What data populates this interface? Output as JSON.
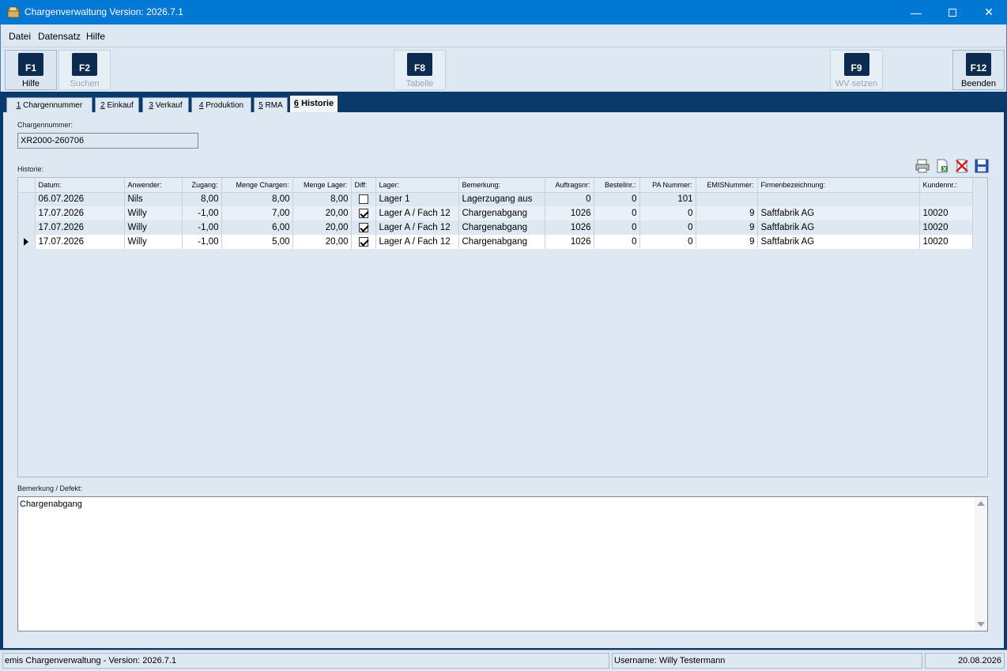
{
  "window": {
    "title": "Chargenverwaltung Version: 2026.7.1"
  },
  "menu": [
    {
      "label": "Datei"
    },
    {
      "label": "Datensatz"
    },
    {
      "label": "Hilfe"
    }
  ],
  "toolbar": [
    {
      "key": "F1",
      "label": "Hilfe"
    },
    {
      "key": "F2",
      "label": "Suchen"
    },
    {
      "key": "F8",
      "label": "Tabelle"
    },
    {
      "key": "F9",
      "label": "WV setzen"
    },
    {
      "key": "F12",
      "label": "Beenden"
    }
  ],
  "tabs": [
    {
      "num": "1",
      "label": "Chargennummer"
    },
    {
      "num": "2",
      "label": "Einkauf"
    },
    {
      "num": "3",
      "label": "Verkauf"
    },
    {
      "num": "4",
      "label": "Produktion"
    },
    {
      "num": "5",
      "label": "RMA"
    },
    {
      "num": "6",
      "label": "Historie"
    }
  ],
  "form": {
    "charge_label": "Chargennummer:",
    "charge_value": "XR2000-260706",
    "history_label": "Historie:",
    "memo_label": "Bemerkung / Defekt:",
    "memo_value": "Chargenabgang"
  },
  "grid": {
    "columns": [
      "Datum:",
      "Anwender:",
      "Zugang:",
      "Menge Chargen:",
      "Menge Lager:",
      "Diff:",
      "Lager:",
      "Bemerkung:",
      "Auftragsnr:",
      "Bestellnr.:",
      "PA Nummer:",
      "EMISNummer:",
      "Firmenbezeichnung:",
      "Kundennr.:"
    ],
    "rows": [
      {
        "datum": "06.07.2026",
        "anwender": "Nils",
        "zugang": "8,00",
        "menge_chargen": "8,00",
        "menge_lager": "8,00",
        "diff": false,
        "lager": "Lager 1",
        "bemerkung": "Lagerzugang aus",
        "auftragsnr": "0",
        "bestellnr": "0",
        "pa_nummer": "101",
        "emis_nummer": "",
        "firma": "",
        "kundennr": ""
      },
      {
        "datum": "17.07.2026",
        "anwender": "Willy",
        "zugang": "-1,00",
        "menge_chargen": "7,00",
        "menge_lager": "20,00",
        "diff": true,
        "lager": "Lager A / Fach 12",
        "bemerkung": "Chargenabgang",
        "auftragsnr": "1026",
        "bestellnr": "0",
        "pa_nummer": "0",
        "emis_nummer": "9",
        "firma": "Saftfabrik AG",
        "kundennr": "10020"
      },
      {
        "datum": "17.07.2026",
        "anwender": "Willy",
        "zugang": "-1,00",
        "menge_chargen": "6,00",
        "menge_lager": "20,00",
        "diff": true,
        "lager": "Lager A / Fach 12",
        "bemerkung": "Chargenabgang",
        "auftragsnr": "1026",
        "bestellnr": "0",
        "pa_nummer": "0",
        "emis_nummer": "9",
        "firma": "Saftfabrik AG",
        "kundennr": "10020"
      },
      {
        "datum": "17.07.2026",
        "anwender": "Willy",
        "zugang": "-1,00",
        "menge_chargen": "5,00",
        "menge_lager": "20,00",
        "diff": true,
        "lager": "Lager A / Fach 12",
        "bemerkung": "Chargenabgang",
        "auftragsnr": "1026",
        "bestellnr": "0",
        "pa_nummer": "0",
        "emis_nummer": "9",
        "firma": "Saftfabrik AG",
        "kundennr": "10020"
      }
    ]
  },
  "status": {
    "app": "emis Chargenverwaltung - Version: 2026.7.1",
    "user": "Username: Willy Testermann",
    "date": "20.08.2026"
  }
}
